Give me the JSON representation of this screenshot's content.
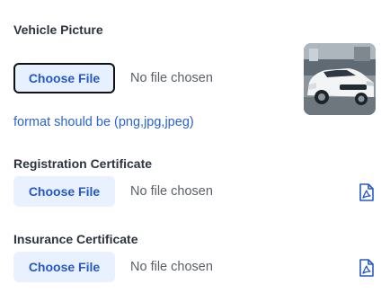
{
  "vehicle_picture": {
    "label": "Vehicle Picture",
    "button_label": "Choose File",
    "status": "No file chosen",
    "format_hint": "format should be (png,jpg,jpeg)",
    "preview_icon": "car-photo-thumbnail"
  },
  "registration_certificate": {
    "label": "Registration Certificate",
    "button_label": "Choose File",
    "status": "No file chosen",
    "file_icon": "pdf-icon"
  },
  "insurance_certificate": {
    "label": "Insurance Certificate",
    "button_label": "Choose File",
    "status": "No file chosen",
    "file_icon": "pdf-icon"
  },
  "colors": {
    "accent": "#2a63d4",
    "button_bg": "#e9f1fe",
    "pdf_icon": "#2558c7"
  }
}
